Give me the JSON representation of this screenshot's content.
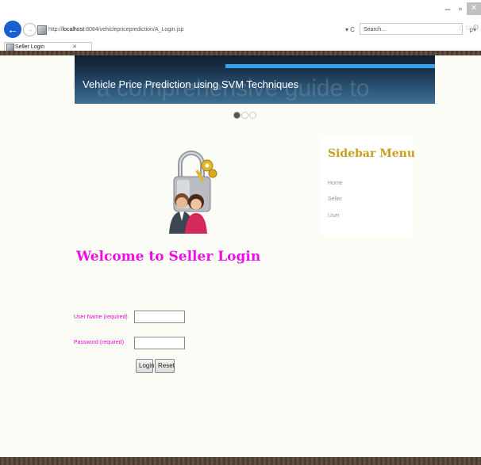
{
  "browser": {
    "window_controls": {
      "minimize": "–",
      "restore": "▫",
      "close": "✕"
    },
    "back_icon": "back-arrow-icon",
    "forward_icon": "forward-arrow-icon",
    "address": {
      "prefix": "http://",
      "host": "localhost",
      "rest": ":8084/vehiclepriceprediction/A_Login.jsp",
      "refresh": "▾ C"
    },
    "search_placeholder": "Search...",
    "search_icon": "ρ▾",
    "toolbar_icons": "⌂☆⚙",
    "tab": {
      "label": "Seller Login",
      "close": "✕"
    }
  },
  "banner": {
    "ghost_text": "a comprehensive guide to",
    "title": "Vehicle Price Prediction using SVM Techniques"
  },
  "slider_dots": 3,
  "login": {
    "heading": "Welcome to Seller Login",
    "username_label": "User Name (required)",
    "password_label": "Password (required)",
    "username_value": "",
    "password_value": "",
    "login_button": "Login",
    "reset_button": "Reset"
  },
  "sidebar": {
    "title": "Sidebar Menu",
    "items": [
      "Home",
      "Seller",
      "User"
    ]
  },
  "colors": {
    "accent_pink": "#ee0ee9",
    "sidebar_title": "#c8a020",
    "banner_bar": "#3aa0ef"
  }
}
